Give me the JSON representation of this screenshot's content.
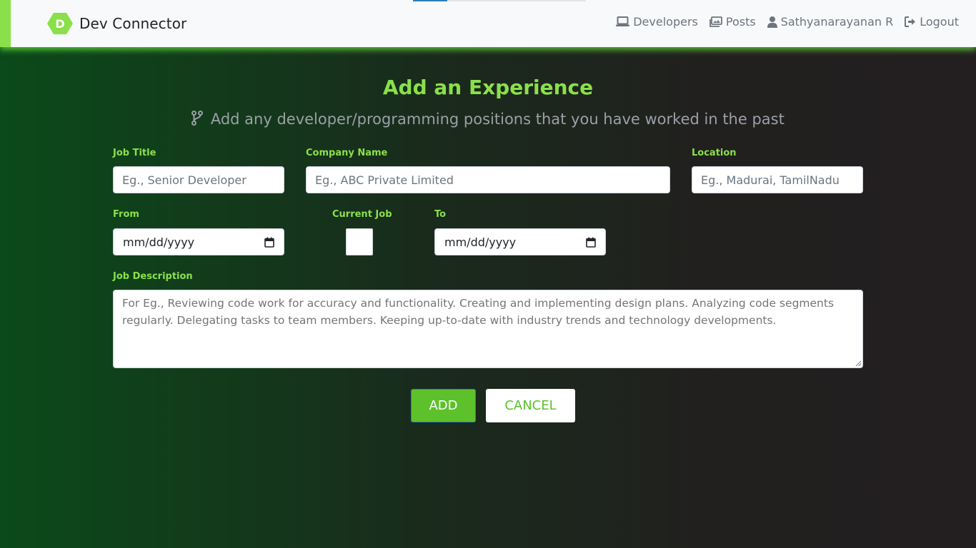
{
  "navbar": {
    "brand_letter": "D",
    "brand_name": "Dev Connector",
    "links": [
      {
        "label": "Developers",
        "icon": "laptop-icon"
      },
      {
        "label": "Posts",
        "icon": "images-icon"
      },
      {
        "label": "Sathyanarayanan R",
        "icon": "user-icon"
      },
      {
        "label": "Logout",
        "icon": "sign-out-icon"
      }
    ]
  },
  "page": {
    "title": "Add an Experience",
    "subtitle": "Add any developer/programming positions that you have worked in the past",
    "subtitle_icon": "code-branch-icon"
  },
  "form": {
    "job_title": {
      "label": "Job Title",
      "placeholder": "Eg., Senior Developer",
      "value": ""
    },
    "company": {
      "label": "Company Name",
      "placeholder": "Eg., ABC Private Limited",
      "value": ""
    },
    "location": {
      "label": "Location",
      "placeholder": "Eg., Madurai, TamilNadu",
      "value": ""
    },
    "from": {
      "label": "From",
      "display": "mm/dd/yyyy"
    },
    "current": {
      "label": "Current Job",
      "checked": false
    },
    "to": {
      "label": "To",
      "display": "mm/dd/yyyy"
    },
    "description": {
      "label": "Job Description",
      "placeholder": "For Eg., Reviewing code work for accuracy and functionality. Creating and implementing design plans. Analyzing code segments regularly. Delegating tasks to team members. Keeping up-to-date with industry trends and technology developments."
    },
    "add_label": "ADD",
    "cancel_label": "CANCEL"
  },
  "colors": {
    "accent": "#8ae04a",
    "button": "#5cc12b",
    "background_left": "#0b4a1a",
    "background_right": "#231f20"
  }
}
